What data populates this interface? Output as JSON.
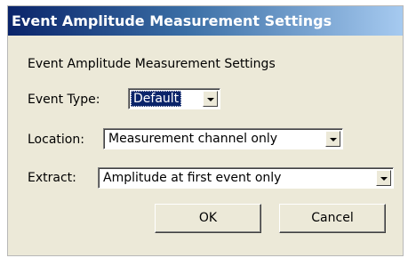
{
  "window": {
    "title": "Event Amplitude Measurement Settings"
  },
  "content": {
    "heading": "Event Amplitude Measurement Settings"
  },
  "fields": {
    "event_type": {
      "label": "Event Type:",
      "value": "Default"
    },
    "location": {
      "label": "Location:",
      "value": "Measurement channel only"
    },
    "extract": {
      "label": "Extract:",
      "value": "Amplitude at first event only"
    }
  },
  "buttons": {
    "ok": "OK",
    "cancel": "Cancel"
  },
  "colors": {
    "titlebar_start": "#0a246a",
    "titlebar_end": "#a6caf0",
    "dialog_bg": "#ece9d8",
    "selection": "#0a246a"
  }
}
